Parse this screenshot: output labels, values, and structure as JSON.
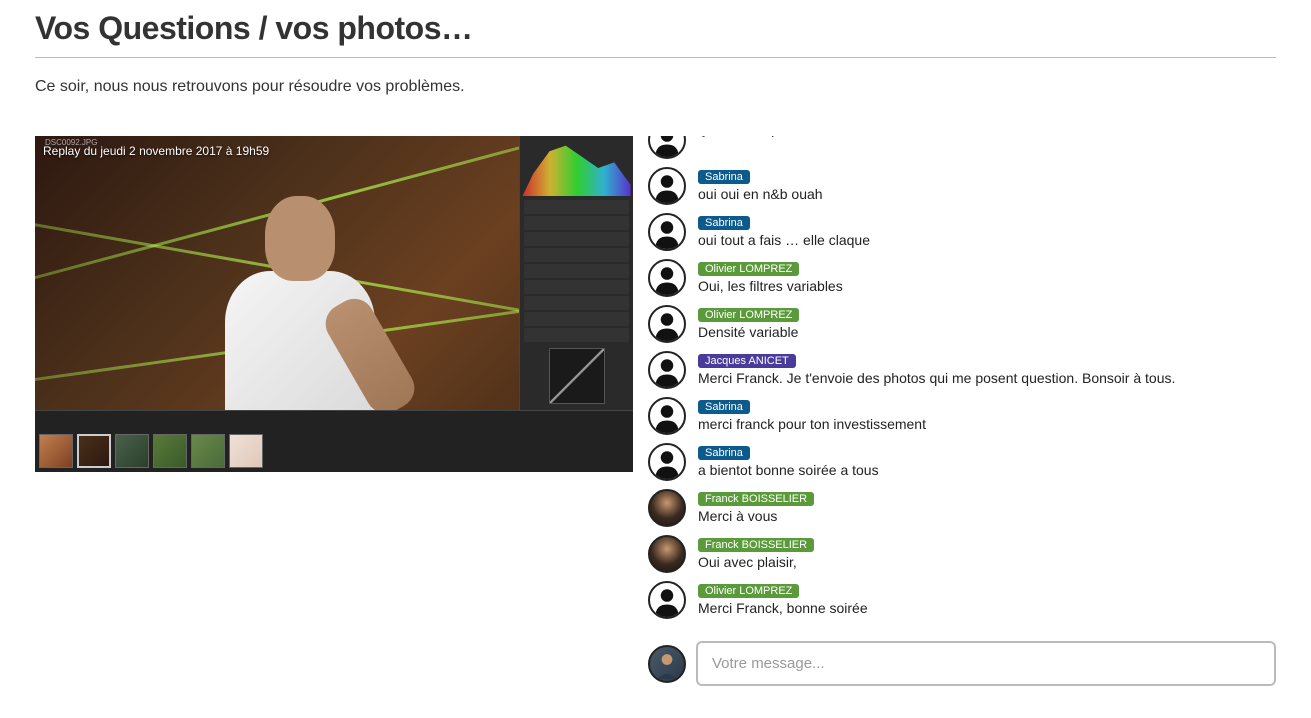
{
  "page": {
    "title": "Vos Questions / vos photos…",
    "subtitle": "Ce soir, nous nous retrouvons pour résoudre vos problèmes."
  },
  "video": {
    "overlay": "Replay du jeudi 2 novembre 2017 à 19h59",
    "filename": "DSC0092.JPG"
  },
  "chat": {
    "messages": [
      {
        "author": "",
        "badgeClass": "",
        "text": "Ça arrache plus en N&B.",
        "avatar": "silhouette"
      },
      {
        "author": "Sabrina",
        "badgeClass": "sabrina",
        "text": "oui oui en n&b ouah",
        "avatar": "silhouette"
      },
      {
        "author": "Sabrina",
        "badgeClass": "sabrina",
        "text": "oui tout a fais … elle claque",
        "avatar": "silhouette"
      },
      {
        "author": "Olivier LOMPREZ",
        "badgeClass": "olivier",
        "text": "Oui, les filtres variables",
        "avatar": "silhouette"
      },
      {
        "author": "Olivier LOMPREZ",
        "badgeClass": "olivier",
        "text": "Densité variable",
        "avatar": "silhouette"
      },
      {
        "author": "Jacques ANICET",
        "badgeClass": "jacques",
        "text": "Merci Franck. Je t'envoie des photos qui me posent question. Bonsoir à tous.",
        "avatar": "silhouette"
      },
      {
        "author": "Sabrina",
        "badgeClass": "sabrina",
        "text": "merci franck pour ton investissement",
        "avatar": "silhouette"
      },
      {
        "author": "Sabrina",
        "badgeClass": "sabrina",
        "text": "a bientot bonne soirée a tous",
        "avatar": "silhouette"
      },
      {
        "author": "Franck BOISSELIER",
        "badgeClass": "franck",
        "text": "Merci à vous",
        "avatar": "franck"
      },
      {
        "author": "Franck BOISSELIER",
        "badgeClass": "franck",
        "text": "Oui avec plaisir,",
        "avatar": "franck"
      },
      {
        "author": "Olivier LOMPREZ",
        "badgeClass": "olivier",
        "text": "Merci Franck, bonne soirée",
        "avatar": "silhouette"
      }
    ],
    "input_placeholder": "Votre message..."
  }
}
